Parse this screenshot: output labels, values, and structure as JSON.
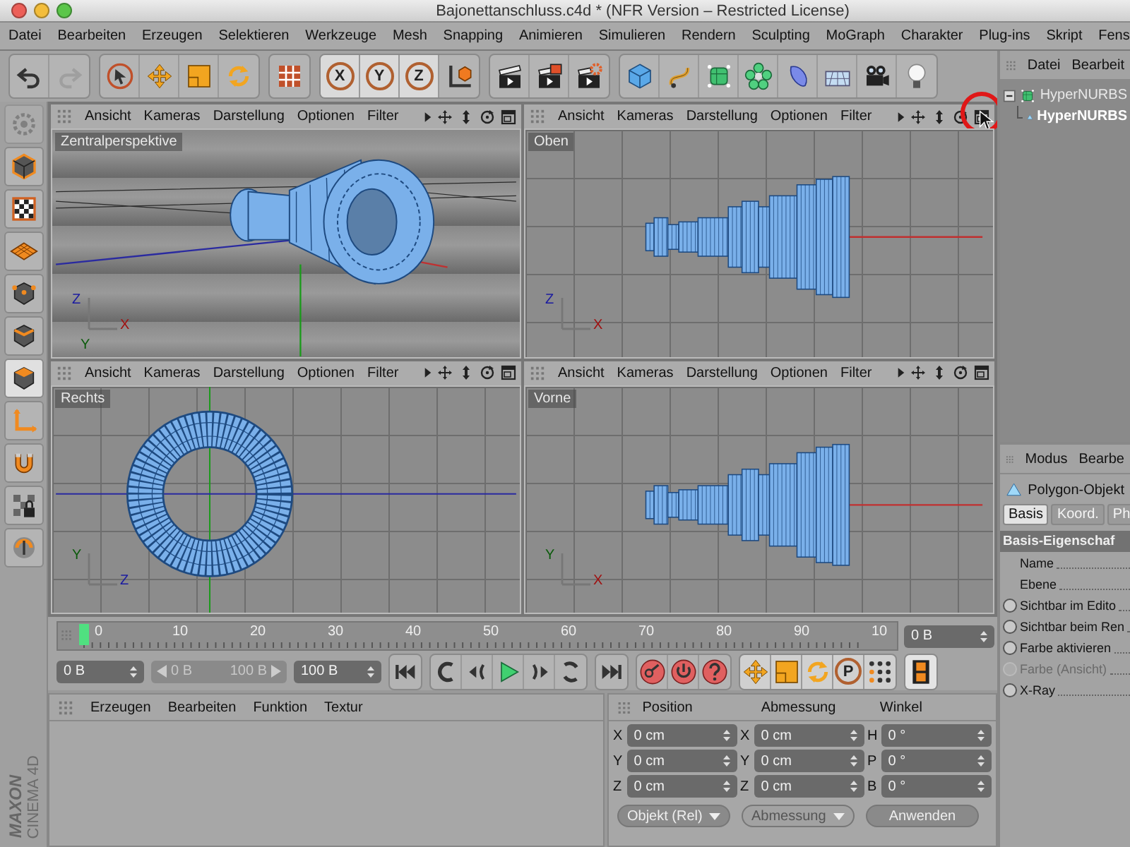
{
  "window": {
    "title": "Bajonettanschluss.c4d * (NFR Version – Restricted License)"
  },
  "menu_bar": [
    "Datei",
    "Bearbeiten",
    "Erzeugen",
    "Selektieren",
    "Werkzeuge",
    "Mesh",
    "Snapping",
    "Animieren",
    "Simulieren",
    "Rendern",
    "Sculpting",
    "MoGraph",
    "Charakter",
    "Plug-ins",
    "Skript",
    "Fens"
  ],
  "toolbar": {
    "axis_locks": [
      {
        "label": "X",
        "on": true
      },
      {
        "label": "Y",
        "on": true
      },
      {
        "label": "Z",
        "on": true
      }
    ]
  },
  "viewports": [
    {
      "kind": "perspective",
      "label": "Zentralperspektive",
      "menu": [
        "Ansicht",
        "Kameras",
        "Darstellung",
        "Optionen",
        "Filter"
      ],
      "gizmo_labels": [
        "Z",
        "X",
        "Y"
      ]
    },
    {
      "kind": "top",
      "label": "Oben",
      "menu": [
        "Ansicht",
        "Kameras",
        "Darstellung",
        "Optionen",
        "Filter"
      ],
      "gizmo_labels": [
        "Z",
        "X"
      ]
    },
    {
      "kind": "side",
      "label": "Rechts",
      "menu": [
        "Ansicht",
        "Kameras",
        "Darstellung",
        "Optionen",
        "Filter"
      ],
      "gizmo_labels": [
        "Y",
        "Z"
      ]
    },
    {
      "kind": "front",
      "label": "Vorne",
      "menu": [
        "Ansicht",
        "Kameras",
        "Darstellung",
        "Optionen",
        "Filter"
      ],
      "gizmo_labels": [
        "Y",
        "X"
      ]
    }
  ],
  "object_manager": {
    "menu": [
      "Datei",
      "Bearbeit"
    ],
    "objects": [
      {
        "name": "HyperNURBS",
        "selected": false,
        "children": [
          {
            "name": "HyperNURBS",
            "selected": true
          }
        ]
      }
    ]
  },
  "attribute_manager": {
    "menu": [
      "Modus",
      "Bearbe"
    ],
    "object_type": "Polygon-Objekt",
    "tabs": [
      {
        "label": "Basis",
        "selected": true
      },
      {
        "label": "Koord.",
        "selected": false
      },
      {
        "label": "Ph",
        "selected": false
      }
    ],
    "section": "Basis-Eigenschaf",
    "fields": [
      {
        "kind": "text",
        "label": "Name",
        "disabled": false
      },
      {
        "kind": "text",
        "label": "Ebene",
        "disabled": false
      },
      {
        "kind": "radio",
        "label": "Sichtbar im Edito",
        "disabled": false
      },
      {
        "kind": "radio",
        "label": "Sichtbar beim Ren",
        "disabled": false
      },
      {
        "kind": "radio",
        "label": "Farbe aktivieren",
        "disabled": false
      },
      {
        "kind": "radio",
        "label": "Farbe (Ansicht)",
        "disabled": true
      },
      {
        "kind": "radio",
        "label": "X-Ray",
        "disabled": false
      }
    ]
  },
  "timeline": {
    "ticks": [
      "0",
      "10",
      "20",
      "30",
      "40",
      "50",
      "60",
      "70",
      "80",
      "90",
      "10"
    ],
    "playhead": {
      "level": 0
    },
    "current_frame": "0 B"
  },
  "transport": {
    "start": "0 B",
    "range_start": "0 B",
    "range_end": "100 B",
    "end": "100 B",
    "param_label": "P"
  },
  "material_manager": {
    "menu": [
      "Erzeugen",
      "Bearbeiten",
      "Funktion",
      "Textur"
    ]
  },
  "coordinates": {
    "headers": [
      "Position",
      "Abmessung",
      "Winkel"
    ],
    "rows": [
      {
        "axes": [
          "X",
          "X",
          "H"
        ],
        "values": [
          "0 cm",
          "0 cm",
          "0 °"
        ]
      },
      {
        "axes": [
          "Y",
          "Y",
          "P"
        ],
        "values": [
          "0 cm",
          "0 cm",
          "0 °"
        ]
      },
      {
        "axes": [
          "Z",
          "Z",
          "B"
        ],
        "values": [
          "0 cm",
          "0 cm",
          "0 °"
        ]
      }
    ],
    "mode_dropdown": {
      "label": "Objekt (Rel)",
      "disabled": false
    },
    "size_dropdown": {
      "label": "Abmessung",
      "disabled": true
    },
    "apply_button": "Anwenden"
  },
  "logo": {
    "brand": "MAXON",
    "product": "CINEMA 4D"
  }
}
